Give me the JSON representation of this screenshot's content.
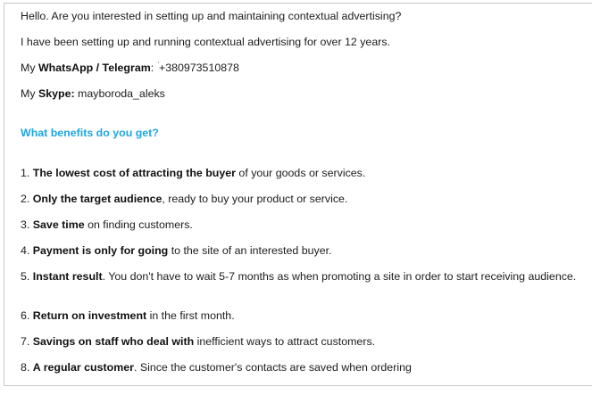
{
  "intro": {
    "greeting": "Hello. Are you interested in setting up and maintaining contextual advertising?",
    "experience": "I have been setting up and running contextual advertising for over 12 years.",
    "contact_label_prefix": "My ",
    "whatsapp_label": "WhatsApp / Telegram",
    "whatsapp_sep": ": ",
    "whatsapp_value": "+380973510878",
    "skype_label_prefix": "My ",
    "skype_label": "Skype:",
    "skype_value": " mayboroda_aleks"
  },
  "benefits": {
    "heading": "What benefits do you get?",
    "items": [
      {
        "num": "1. ",
        "bold": "The lowest cost of attracting the buyer",
        "rest": " of your goods or services."
      },
      {
        "num": "2. ",
        "bold": "Only the target audience",
        "rest": ", ready to buy your product or service."
      },
      {
        "num": "3. ",
        "bold": "Save time",
        "rest": " on finding customers."
      },
      {
        "num": "4. ",
        "bold": "Payment is only for going",
        "rest": " to the site of an interested buyer."
      },
      {
        "num": "5. ",
        "bold": "Instant result",
        "rest": ". You don't have to wait 5-7 months as when promoting a site in order to start receiving audience."
      },
      {
        "num": "6. ",
        "bold": "Return on investment",
        "rest": " in the first month."
      },
      {
        "num": "7. ",
        "bold": "Savings on staff who deal with",
        "rest": " inefficient ways to attract customers."
      },
      {
        "num": "8. ",
        "bold": "A regular customer",
        "rest": ". Since the customer's contacts are saved when ordering"
      }
    ]
  }
}
